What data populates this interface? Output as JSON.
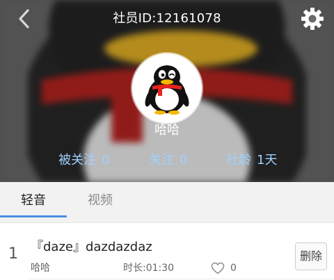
{
  "header": {
    "member_id": "社员ID:12161078",
    "nickname": "哈哈",
    "icons": {
      "back": "chevron-left-icon",
      "settings": "gear-icon",
      "avatar": "penguin-avatar"
    }
  },
  "stats": {
    "followers": {
      "label": "被关注",
      "value": "0"
    },
    "following": {
      "label": "关注",
      "value": "0"
    },
    "age": {
      "label": "社龄",
      "value": "1天"
    }
  },
  "tabs": [
    {
      "label": "轻音",
      "active": true
    },
    {
      "label": "视频",
      "active": false
    }
  ],
  "list": [
    {
      "index": "1",
      "title": "『daze』dazdazdaz",
      "author": "哈哈",
      "duration": "时长:01:30",
      "likes": "0",
      "delete_label": "删除"
    }
  ],
  "colors": {
    "stat_text": "#9fd0ff",
    "tab_indicator": "#4a90e2",
    "scarf_red": "#e8231d",
    "beak_yellow": "#f5b800"
  }
}
